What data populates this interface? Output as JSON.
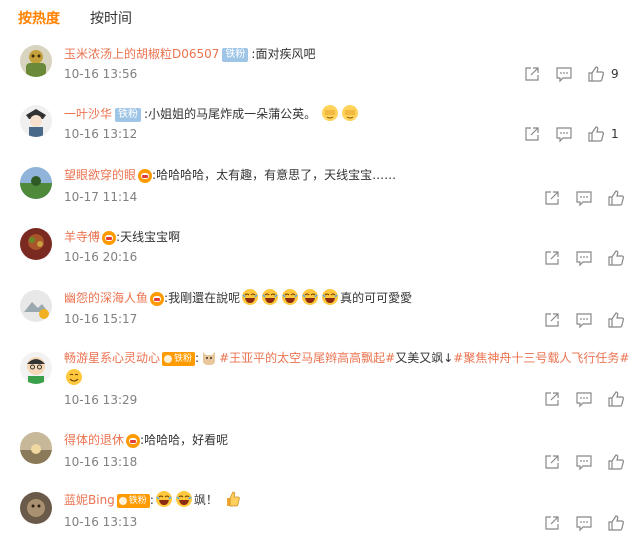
{
  "tabs": {
    "hot": "按热度",
    "time": "按时间"
  },
  "comments": [
    {
      "user": "玉米浓汤上的胡椒粒D06507",
      "badge": "铁粉",
      "sep": ":",
      "text": "面对疾风吧",
      "time": "10-16 13:56",
      "likes": "9"
    },
    {
      "user": "一叶沙华",
      "badge": "铁粉",
      "sep": ":",
      "text": "小姐姐的马尾炸成一朵蒲公英。",
      "time": "10-16 13:12",
      "likes": "1"
    },
    {
      "user": "望眼欲穿的眼",
      "sep": ":",
      "text": "哈哈哈哈，太有趣，有意思了，天线宝宝……",
      "time": "10-17 11:14"
    },
    {
      "user": "羊寺傅",
      "sep": ":",
      "text": "天线宝宝啊",
      "time": "10-16 20:16"
    },
    {
      "user": "幽怨的深海人鱼",
      "sep": ":",
      "text": "我剛還在說呢",
      "text_after": "真的可可愛愛",
      "time": "10-16 15:17"
    },
    {
      "user": "畅游星系心灵动心",
      "badge": "铁粉",
      "sep": ":",
      "topic1": "#王亚平的太空马尾辫高高飘起#",
      "text": "又美又飒↓",
      "topic2": "#聚焦神舟十三号载人飞行任务#",
      "time": "10-16 13:29"
    },
    {
      "user": "得体的退休",
      "sep": ":",
      "text": "哈哈哈，好看呢",
      "time": "10-16 13:18"
    },
    {
      "user": "蓝妮Bing",
      "badge": "铁粉",
      "sep": ":",
      "text": "飒！",
      "time": "10-16 13:13"
    }
  ],
  "colors": {
    "active_tab": "#ff8200",
    "username": "#eb7350",
    "time": "#808080",
    "fan_badge": "#9ec5e6"
  },
  "icons": [
    "forward-icon",
    "comment-icon",
    "like-icon",
    "vip-badge-icon",
    "laugh-emoji-icon",
    "facepalm-emoji-icon",
    "smile-emoji-icon",
    "thumbs-up-emoji-icon",
    "cat-emoji-icon"
  ]
}
